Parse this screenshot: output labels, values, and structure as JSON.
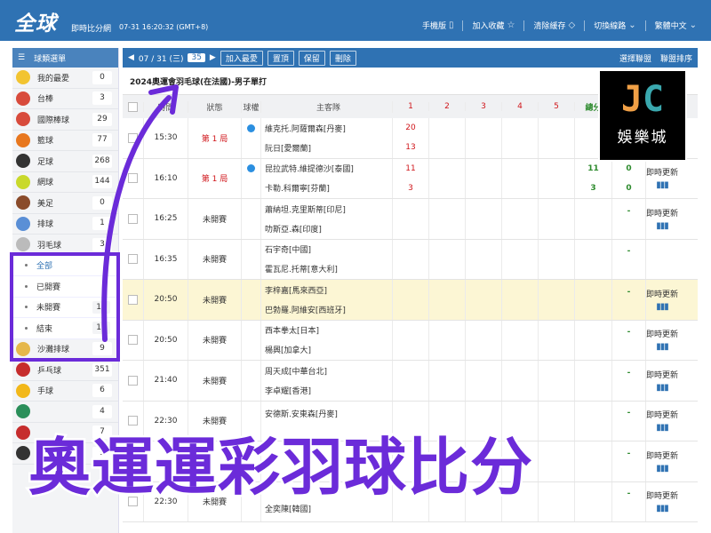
{
  "header": {
    "logo": "全球",
    "subtitle": "即時比分網",
    "datetime": "07-31 16:20:32 (GMT+8)",
    "nav": [
      {
        "label": "手機版",
        "icon": "phone-icon",
        "glyph": "▯"
      },
      {
        "label": "加入收藏",
        "icon": "star-outline-icon",
        "glyph": "☆"
      },
      {
        "label": "清除緩存",
        "icon": "eraser-icon",
        "glyph": "◇"
      },
      {
        "label": "切換線路",
        "icon": "chevron-down-icon",
        "glyph": "⌄"
      },
      {
        "label": "繁體中文",
        "icon": "chevron-down-icon",
        "glyph": "⌄"
      }
    ]
  },
  "sidebar": {
    "title": "球類選單",
    "items": [
      {
        "label": "我的最愛",
        "count": "0",
        "color": "#f2c431"
      },
      {
        "label": "台棒",
        "count": "3",
        "color": "#d84b3c"
      },
      {
        "label": "國際棒球",
        "count": "29",
        "color": "#d84b3c"
      },
      {
        "label": "籃球",
        "count": "77",
        "color": "#e8771e"
      },
      {
        "label": "足球",
        "count": "268",
        "color": "#333333"
      },
      {
        "label": "網球",
        "count": "144",
        "color": "#c9d92b"
      },
      {
        "label": "美足",
        "count": "0",
        "color": "#8a4b2a"
      },
      {
        "label": "排球",
        "count": "1",
        "color": "#5a8fd6"
      },
      {
        "label": "羽毛球",
        "count": "3",
        "color": "#bbbbbb"
      }
    ],
    "sub_items": [
      {
        "label": "全部",
        "count": ""
      },
      {
        "label": "已開賽",
        "count": ""
      },
      {
        "label": "未開賽",
        "count": "18"
      },
      {
        "label": "結束",
        "count": "15"
      }
    ],
    "more_items": [
      {
        "label": "沙灘排球",
        "count": "9",
        "color": "#e6b84a"
      },
      {
        "label": "乒乓球",
        "count": "351",
        "color": "#c62d2d"
      },
      {
        "label": "手球",
        "count": "6",
        "color": "#f2b81a"
      },
      {
        "label": "",
        "count": "4",
        "color": "#2b8f5a"
      },
      {
        "label": "",
        "count": "7",
        "color": "#c62d2d"
      },
      {
        "label": "",
        "count": "9",
        "color": "#333333"
      }
    ]
  },
  "toolbar": {
    "date": "07 / 31 (三)",
    "count": "35",
    "buttons": [
      "加入最愛",
      "置頂",
      "保留",
      "刪除"
    ],
    "right": [
      "選擇聯盟",
      "聯盟排序"
    ]
  },
  "competition": "2024奧運會羽毛球(在法國)-男子單打",
  "columns": {
    "time": "時間",
    "state": "狀態",
    "serve": "球權",
    "teams": "主客隊",
    "s1": "1",
    "s2": "2",
    "s3": "3",
    "s4": "4",
    "s5": "5",
    "g": "總分"
  },
  "matches": [
    {
      "time": "15:30",
      "state": "第 1 局",
      "live": true,
      "serve": [
        "#2b8fe0",
        ""
      ],
      "home": "維克托.阿薩爾森[丹麥]",
      "away": "阮日[愛爾蘭]",
      "s1": [
        "20",
        "13"
      ],
      "g1": [
        "",
        ""
      ],
      "g2": [
        "",
        ""
      ],
      "update": "",
      "yellow": false
    },
    {
      "time": "16:10",
      "state": "第 1 局",
      "live": true,
      "serve": [
        "#2b8fe0",
        ""
      ],
      "home": "昆拉武特.維提德沙[泰國]",
      "away": "卡勒.科爾寧[芬蘭]",
      "s1": [
        "11",
        "3"
      ],
      "g1": [
        "11",
        "3"
      ],
      "g2": [
        "0",
        "0"
      ],
      "update": "即時更新",
      "yellow": false
    },
    {
      "time": "16:25",
      "state": "未開賽",
      "live": false,
      "serve": [
        "",
        ""
      ],
      "home": "蕭納坦.克里斯蒂[印尼]",
      "away": "叻斯亞.森[印度]",
      "s1": [
        "",
        ""
      ],
      "g1": [
        "",
        ""
      ],
      "g2": [
        "-",
        ""
      ],
      "update": "即時更新",
      "yellow": false
    },
    {
      "time": "16:35",
      "state": "未開賽",
      "live": false,
      "serve": [
        "",
        ""
      ],
      "home": "石宇奇[中國]",
      "away": "霍瓦尼.托蒂[意大利]",
      "s1": [
        "",
        ""
      ],
      "g1": [
        "",
        ""
      ],
      "g2": [
        "-",
        ""
      ],
      "update": "",
      "yellow": false
    },
    {
      "time": "20:50",
      "state": "未開賽",
      "live": false,
      "serve": [
        "",
        ""
      ],
      "home": "李梓嘉[馬來西亞]",
      "away": "巴勃羅.阿維安[西班牙]",
      "s1": [
        "",
        ""
      ],
      "g1": [
        "",
        ""
      ],
      "g2": [
        "-",
        ""
      ],
      "update": "即時更新",
      "yellow": true
    },
    {
      "time": "20:50",
      "state": "未開賽",
      "live": false,
      "serve": [
        "",
        ""
      ],
      "home": "西本拳太[日本]",
      "away": "楊興[加拿大]",
      "s1": [
        "",
        ""
      ],
      "g1": [
        "",
        ""
      ],
      "g2": [
        "-",
        ""
      ],
      "update": "即時更新",
      "yellow": false
    },
    {
      "time": "21:40",
      "state": "未開賽",
      "live": false,
      "serve": [
        "",
        ""
      ],
      "home": "周天成[中華台北]",
      "away": "李卓耀[香港]",
      "s1": [
        "",
        ""
      ],
      "g1": [
        "",
        ""
      ],
      "g2": [
        "-",
        ""
      ],
      "update": "即時更新",
      "yellow": false
    },
    {
      "time": "22:30",
      "state": "未開賽",
      "live": false,
      "serve": [
        "",
        ""
      ],
      "home": "安德斯.安東森[丹麥]",
      "away": "",
      "s1": [
        "",
        ""
      ],
      "g1": [
        "",
        ""
      ],
      "g2": [
        "-",
        ""
      ],
      "update": "即時更新",
      "yellow": false
    },
    {
      "time": "",
      "state": "",
      "live": false,
      "serve": [
        "",
        ""
      ],
      "home": "",
      "away": "",
      "s1": [
        "",
        ""
      ],
      "g1": [
        "",
        ""
      ],
      "g2": [
        "-",
        ""
      ],
      "update": "即時更新",
      "yellow": false
    },
    {
      "time": "22:30",
      "state": "未開賽",
      "live": false,
      "serve": [
        "",
        ""
      ],
      "home": "",
      "away": "全奕陳[韓國]",
      "s1": [
        "",
        ""
      ],
      "g1": [
        "",
        ""
      ],
      "g2": [
        "-",
        ""
      ],
      "update": "即時更新",
      "yellow": false
    }
  ],
  "badge": {
    "main_j": "J",
    "main_c": "C",
    "sub": "娛樂城"
  },
  "overlay": "奧運運彩羽球比分",
  "colors": {
    "brand": "#2f72b3",
    "highlight": "#6b2bd9",
    "live_red": "#d0161b",
    "score_green": "#2e8b2e"
  }
}
